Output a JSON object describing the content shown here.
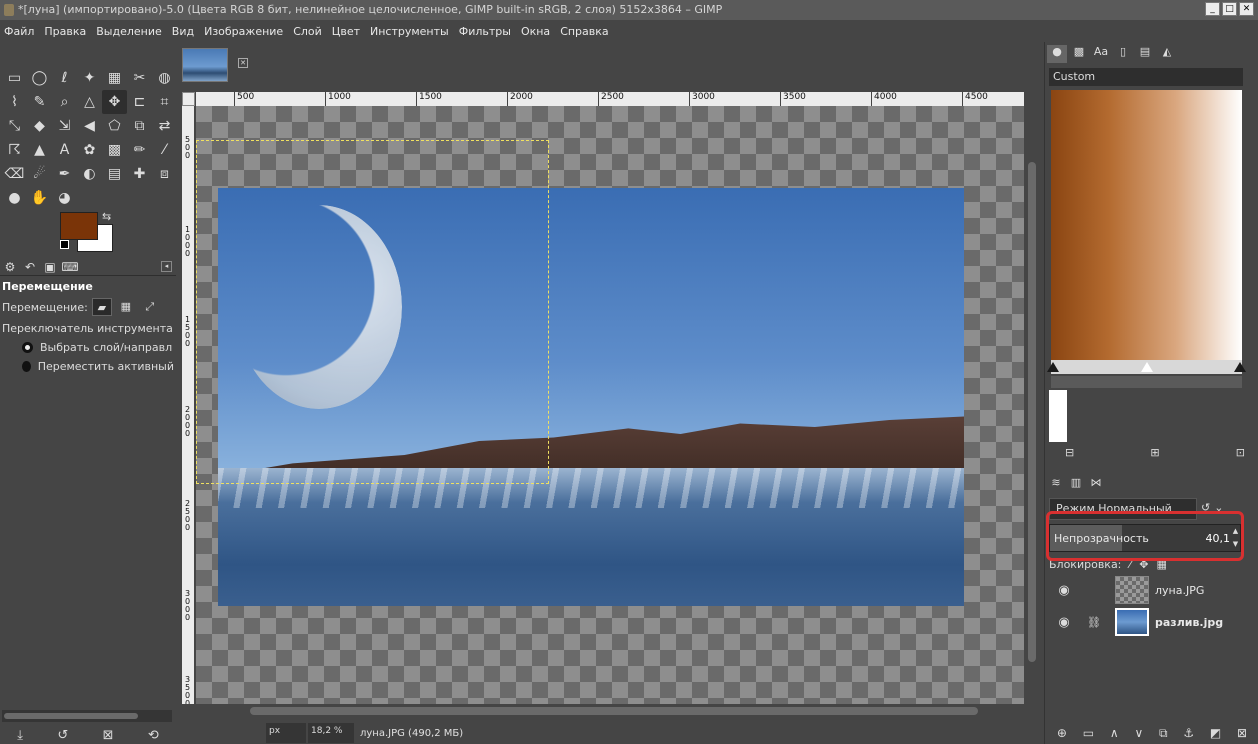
{
  "window": {
    "title": "*[луна] (импортировано)-5.0 (Цвета RGB 8 бит, нелинейное целочисленное, GIMP built-in sRGB, 2 слоя) 5152x3864 – GIMP"
  },
  "menu": [
    "Файл",
    "Правка",
    "Выделение",
    "Вид",
    "Изображение",
    "Слой",
    "Цвет",
    "Инструменты",
    "Фильтры",
    "Окна",
    "Справка"
  ],
  "colors": {
    "foreground": "#7a3408",
    "background": "#ffffff",
    "highlight": "#d83030"
  },
  "tool_options": {
    "title": "Перемещение",
    "move_label": "Перемещение:",
    "switch_label": "Переключатель инструмента",
    "opt1": "Выбрать слой/направл",
    "opt2": "Переместить активный"
  },
  "ruler": {
    "top": [
      "500",
      "1000",
      "1500",
      "2000",
      "2500",
      "3000",
      "3500",
      "4000",
      "4500"
    ],
    "left": [
      "500",
      "1000",
      "1500",
      "2000",
      "2500",
      "3000",
      "3500"
    ]
  },
  "status": {
    "unit": "px",
    "zoom": "18,2 %",
    "info": "луна.JPG (490,2 МБ)"
  },
  "gradient": {
    "name": "Custom"
  },
  "layers_panel": {
    "mode": "Режим Нормальный",
    "opacity_label": "Непрозрачность",
    "opacity_value": "40,1",
    "lock_label": "Блокировка:",
    "layers": [
      {
        "name": "луна.JPG"
      },
      {
        "name": "разлив.jpg"
      }
    ]
  }
}
